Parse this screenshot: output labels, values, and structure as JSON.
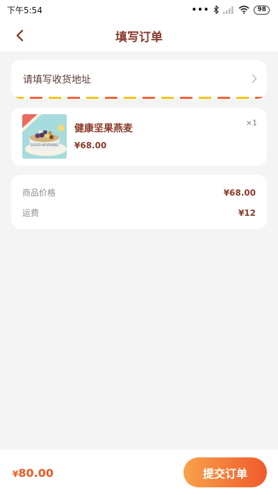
{
  "status_bar": {
    "time": "下午5:54",
    "battery": "98",
    "icons": [
      "more-dots-icon",
      "bluetooth-icon",
      "signal-icon",
      "wifi-icon",
      "battery-icon"
    ]
  },
  "header": {
    "title": "填写订单",
    "back_icon": "chevron-left-icon"
  },
  "address": {
    "placeholder": "请填写收货地址",
    "arrow_icon": "chevron-right-icon"
  },
  "product": {
    "name": "健康坚果燕麦",
    "price": "¥68.00",
    "quantity": "×1",
    "image_text": "GOOD MORNING"
  },
  "summary": {
    "rows": [
      {
        "label": "商品价格",
        "value": "¥68.00"
      },
      {
        "label": "运费",
        "value": "¥12"
      }
    ]
  },
  "footer": {
    "currency": "¥",
    "total": "80.00",
    "submit_label": "提交订单"
  },
  "colors": {
    "accent": "#f05a24",
    "title": "#8a3b2b",
    "stripe_yellow": "#f5c518",
    "stripe_red": "#f0643c"
  }
}
